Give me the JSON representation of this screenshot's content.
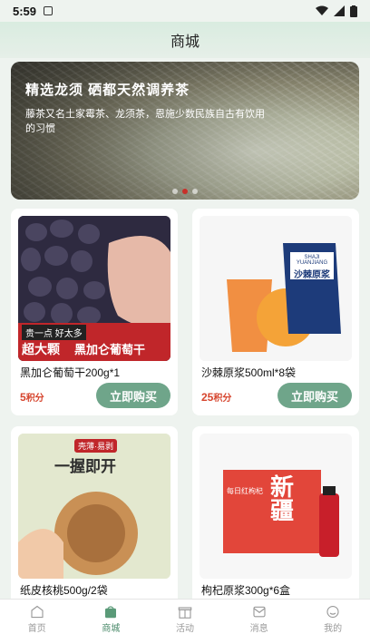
{
  "status": {
    "time": "5:59"
  },
  "header": {
    "title": "商城"
  },
  "banner": {
    "title": "精选龙须  硒都天然调养茶",
    "desc": "藤茶又名土家霉茶、龙须茶，恩施少数民族自古有饮用的习惯",
    "slides": 3,
    "active_slide": 1
  },
  "products": [
    {
      "name": "黑加仑葡萄干200g*1",
      "price": "5",
      "unit": "积分",
      "buy": "立即购买",
      "img_text": {
        "tag": "贵一点 好太多",
        "big": "超大颗",
        "sub": "黑加仑葡萄干"
      }
    },
    {
      "name": "沙棘原浆500ml*8袋",
      "price": "25",
      "unit": "积分",
      "buy": "立即购买",
      "img_text": {
        "brand": "SHAJI YUANJIANG",
        "cn": "沙棘原浆"
      }
    },
    {
      "name": "纸皮核桃500g/2袋",
      "price": "",
      "unit": "",
      "buy": "",
      "img_text": {
        "top": "一握即开",
        "small": "壳薄·易剥"
      }
    },
    {
      "name": "枸杞原浆300g*6盒",
      "price": "",
      "unit": "",
      "buy": "",
      "img_text": {
        "big": "新疆",
        "small": "每日红枸杞"
      }
    }
  ],
  "tabs": [
    {
      "label": "首页",
      "icon": "home-icon"
    },
    {
      "label": "商城",
      "icon": "shopping-bag-icon"
    },
    {
      "label": "活动",
      "icon": "gift-icon"
    },
    {
      "label": "消息",
      "icon": "message-icon"
    },
    {
      "label": "我的",
      "icon": "user-icon"
    }
  ],
  "colors": {
    "accent": "#6fa58a",
    "price": "#d6452e",
    "active_dot": "#c8302a"
  }
}
